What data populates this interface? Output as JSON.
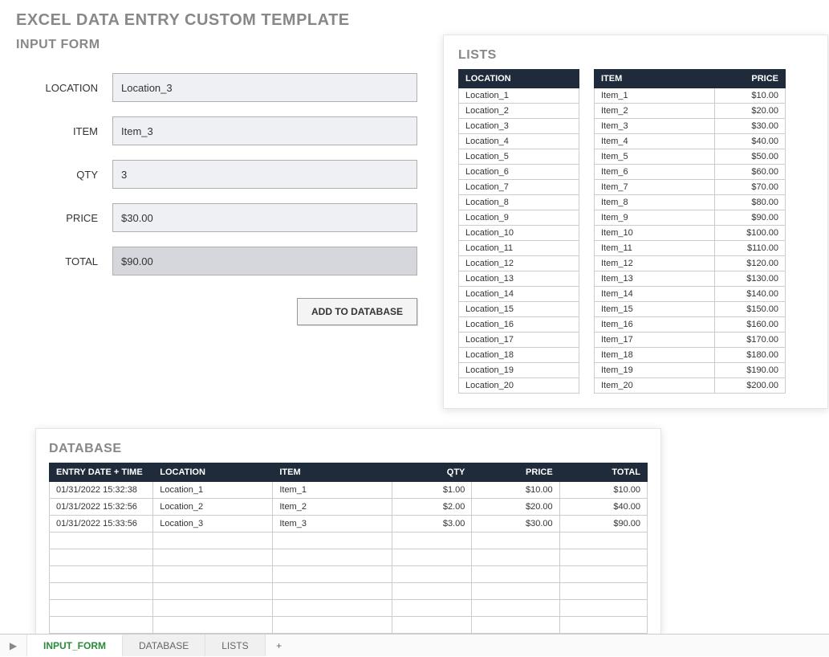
{
  "page_title": "EXCEL DATA ENTRY CUSTOM TEMPLATE",
  "input_form": {
    "title": "INPUT FORM",
    "labels": {
      "location": "LOCATION",
      "item": "ITEM",
      "qty": "QTY",
      "price": "PRICE",
      "total": "TOTAL"
    },
    "values": {
      "location": "Location_3",
      "item": "Item_3",
      "qty": "3",
      "price": "$30.00",
      "total": "$90.00"
    },
    "add_button": "ADD TO DATABASE"
  },
  "lists": {
    "title": "LISTS",
    "location_header": "LOCATION",
    "item_header": "ITEM",
    "price_header": "PRICE",
    "locations": [
      "Location_1",
      "Location_2",
      "Location_3",
      "Location_4",
      "Location_5",
      "Location_6",
      "Location_7",
      "Location_8",
      "Location_9",
      "Location_10",
      "Location_11",
      "Location_12",
      "Location_13",
      "Location_14",
      "Location_15",
      "Location_16",
      "Location_17",
      "Location_18",
      "Location_19",
      "Location_20"
    ],
    "items": [
      {
        "name": "Item_1",
        "price": "$10.00"
      },
      {
        "name": "Item_2",
        "price": "$20.00"
      },
      {
        "name": "Item_3",
        "price": "$30.00"
      },
      {
        "name": "Item_4",
        "price": "$40.00"
      },
      {
        "name": "Item_5",
        "price": "$50.00"
      },
      {
        "name": "Item_6",
        "price": "$60.00"
      },
      {
        "name": "Item_7",
        "price": "$70.00"
      },
      {
        "name": "Item_8",
        "price": "$80.00"
      },
      {
        "name": "Item_9",
        "price": "$90.00"
      },
      {
        "name": "Item_10",
        "price": "$100.00"
      },
      {
        "name": "Item_11",
        "price": "$110.00"
      },
      {
        "name": "Item_12",
        "price": "$120.00"
      },
      {
        "name": "Item_13",
        "price": "$130.00"
      },
      {
        "name": "Item_14",
        "price": "$140.00"
      },
      {
        "name": "Item_15",
        "price": "$150.00"
      },
      {
        "name": "Item_16",
        "price": "$160.00"
      },
      {
        "name": "Item_17",
        "price": "$170.00"
      },
      {
        "name": "Item_18",
        "price": "$180.00"
      },
      {
        "name": "Item_19",
        "price": "$190.00"
      },
      {
        "name": "Item_20",
        "price": "$200.00"
      }
    ]
  },
  "database": {
    "title": "DATABASE",
    "headers": {
      "entry": "ENTRY DATE + TIME",
      "location": "LOCATION",
      "item": "ITEM",
      "qty": "QTY",
      "price": "PRICE",
      "total": "TOTAL"
    },
    "rows": [
      {
        "entry": "01/31/2022 15:32:38",
        "location": "Location_1",
        "item": "Item_1",
        "qty": "$1.00",
        "price": "$10.00",
        "total": "$10.00"
      },
      {
        "entry": "01/31/2022 15:32:56",
        "location": "Location_2",
        "item": "Item_2",
        "qty": "$2.00",
        "price": "$20.00",
        "total": "$40.00"
      },
      {
        "entry": "01/31/2022 15:33:56",
        "location": "Location_3",
        "item": "Item_3",
        "qty": "$3.00",
        "price": "$30.00",
        "total": "$90.00"
      }
    ],
    "empty_rows": 6
  },
  "tabs": {
    "active": "INPUT_FORM",
    "items": [
      "INPUT_FORM",
      "DATABASE",
      "LISTS"
    ],
    "add": "+"
  }
}
